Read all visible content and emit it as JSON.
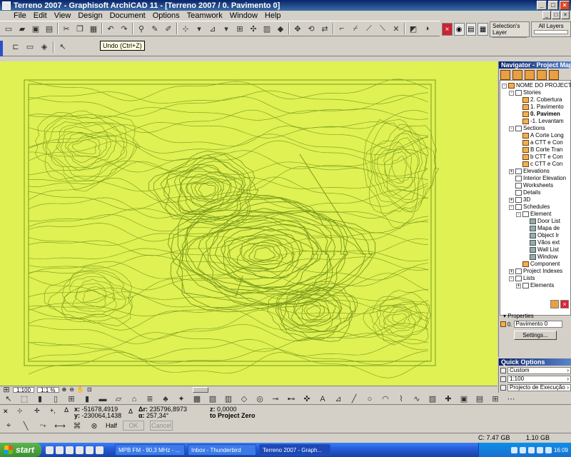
{
  "window": {
    "title": "Terreno 2007 - Graphisoft ArchiCAD 11 - [Terreno 2007 / 0. Pavimento 0]",
    "controls": [
      "_",
      "□",
      "×"
    ]
  },
  "menu": [
    "File",
    "Edit",
    "View",
    "Design",
    "Document",
    "Options",
    "Teamwork",
    "Window",
    "Help"
  ],
  "layers": {
    "selection_label": "Selection's Layer",
    "all_label": "All Layers"
  },
  "tooltip": "Undo (Ctrl+Z)",
  "canvas": {
    "background": "#dff153",
    "line_color": "#7a9a1c"
  },
  "scroll": {
    "scale": "1:100",
    "zoom": "1:1 %"
  },
  "coords": {
    "x_label": "x:",
    "x_value": "-51678,4919",
    "y_label": "y:",
    "y_value": "-230064,1438",
    "dr_label": "Δr:",
    "dr_value": "235796,8973",
    "a_label": "α:",
    "a_value": "257,34°",
    "z_label": "z:",
    "z_value": "0,0000",
    "z_ref": "to Project Zero"
  },
  "infobox": {
    "half": "Half",
    "ok": "OK",
    "cancel": "Cancel"
  },
  "status": {
    "disk": "C: 7.47 GB",
    "ram": "1.10 GB"
  },
  "navigator": {
    "title": "Navigator - Project Map ▾",
    "tree": [
      {
        "label": "NOME DO PROJECTO",
        "level": 0,
        "icon": "folder",
        "exp": "-"
      },
      {
        "label": "Stories",
        "level": 1,
        "icon": "doc",
        "exp": "-"
      },
      {
        "label": "2. Cobertura",
        "level": 2,
        "icon": "folder",
        "exp": ""
      },
      {
        "label": "1. Pavimento",
        "level": 2,
        "icon": "folder",
        "exp": ""
      },
      {
        "label": "0. Pavimen",
        "level": 2,
        "icon": "folder",
        "exp": "",
        "bold": true
      },
      {
        "label": "-1. Levantam",
        "level": 2,
        "icon": "folder",
        "exp": ""
      },
      {
        "label": "Sections",
        "level": 1,
        "icon": "doc",
        "exp": "-"
      },
      {
        "label": "A Corte Long",
        "level": 2,
        "icon": "folder",
        "exp": ""
      },
      {
        "label": "a CTT e Con",
        "level": 2,
        "icon": "folder",
        "exp": ""
      },
      {
        "label": "B Corte Tran",
        "level": 2,
        "icon": "folder",
        "exp": ""
      },
      {
        "label": "b CTT e Con",
        "level": 2,
        "icon": "folder",
        "exp": ""
      },
      {
        "label": "c CTT e Con",
        "level": 2,
        "icon": "folder",
        "exp": ""
      },
      {
        "label": "Elevations",
        "level": 1,
        "icon": "doc",
        "exp": "+"
      },
      {
        "label": "Interior Elevation",
        "level": 1,
        "icon": "doc",
        "exp": ""
      },
      {
        "label": "Worksheets",
        "level": 1,
        "icon": "doc",
        "exp": ""
      },
      {
        "label": "Details",
        "level": 1,
        "icon": "doc",
        "exp": ""
      },
      {
        "label": "3D",
        "level": 1,
        "icon": "doc",
        "exp": "+"
      },
      {
        "label": "Schedules",
        "level": 1,
        "icon": "doc",
        "exp": "-"
      },
      {
        "label": "Element",
        "level": 2,
        "icon": "doc",
        "exp": "-"
      },
      {
        "label": "Door List",
        "level": 3,
        "icon": "grid",
        "exp": ""
      },
      {
        "label": "Mapa de",
        "level": 3,
        "icon": "grid",
        "exp": ""
      },
      {
        "label": "Object Ir",
        "level": 3,
        "icon": "grid",
        "exp": ""
      },
      {
        "label": "Vãos ext",
        "level": 3,
        "icon": "grid",
        "exp": ""
      },
      {
        "label": "Wall List",
        "level": 3,
        "icon": "grid",
        "exp": ""
      },
      {
        "label": "Window",
        "level": 3,
        "icon": "grid",
        "exp": ""
      },
      {
        "label": "Component",
        "level": 2,
        "icon": "folder",
        "exp": ""
      },
      {
        "label": "Project Indexes",
        "level": 1,
        "icon": "doc",
        "exp": "+"
      },
      {
        "label": "Lists",
        "level": 1,
        "icon": "doc",
        "exp": "-"
      },
      {
        "label": "Elements",
        "level": 2,
        "icon": "doc",
        "exp": "+"
      }
    ],
    "properties_title": "Properties",
    "properties_id": "0.",
    "properties_value": "Pavimento 0",
    "settings": "Settings..."
  },
  "quick_options": {
    "title": "Quick Options",
    "rows": [
      "Custom",
      "1:100",
      "Projecto de Execução"
    ]
  },
  "taskbar": {
    "start": "start",
    "tasks": [
      "MPB FM - 90,3 MHz - ...",
      "Inbox - Thunderbird",
      "Terreno 2007 - Graph..."
    ],
    "clock": "16:09"
  }
}
